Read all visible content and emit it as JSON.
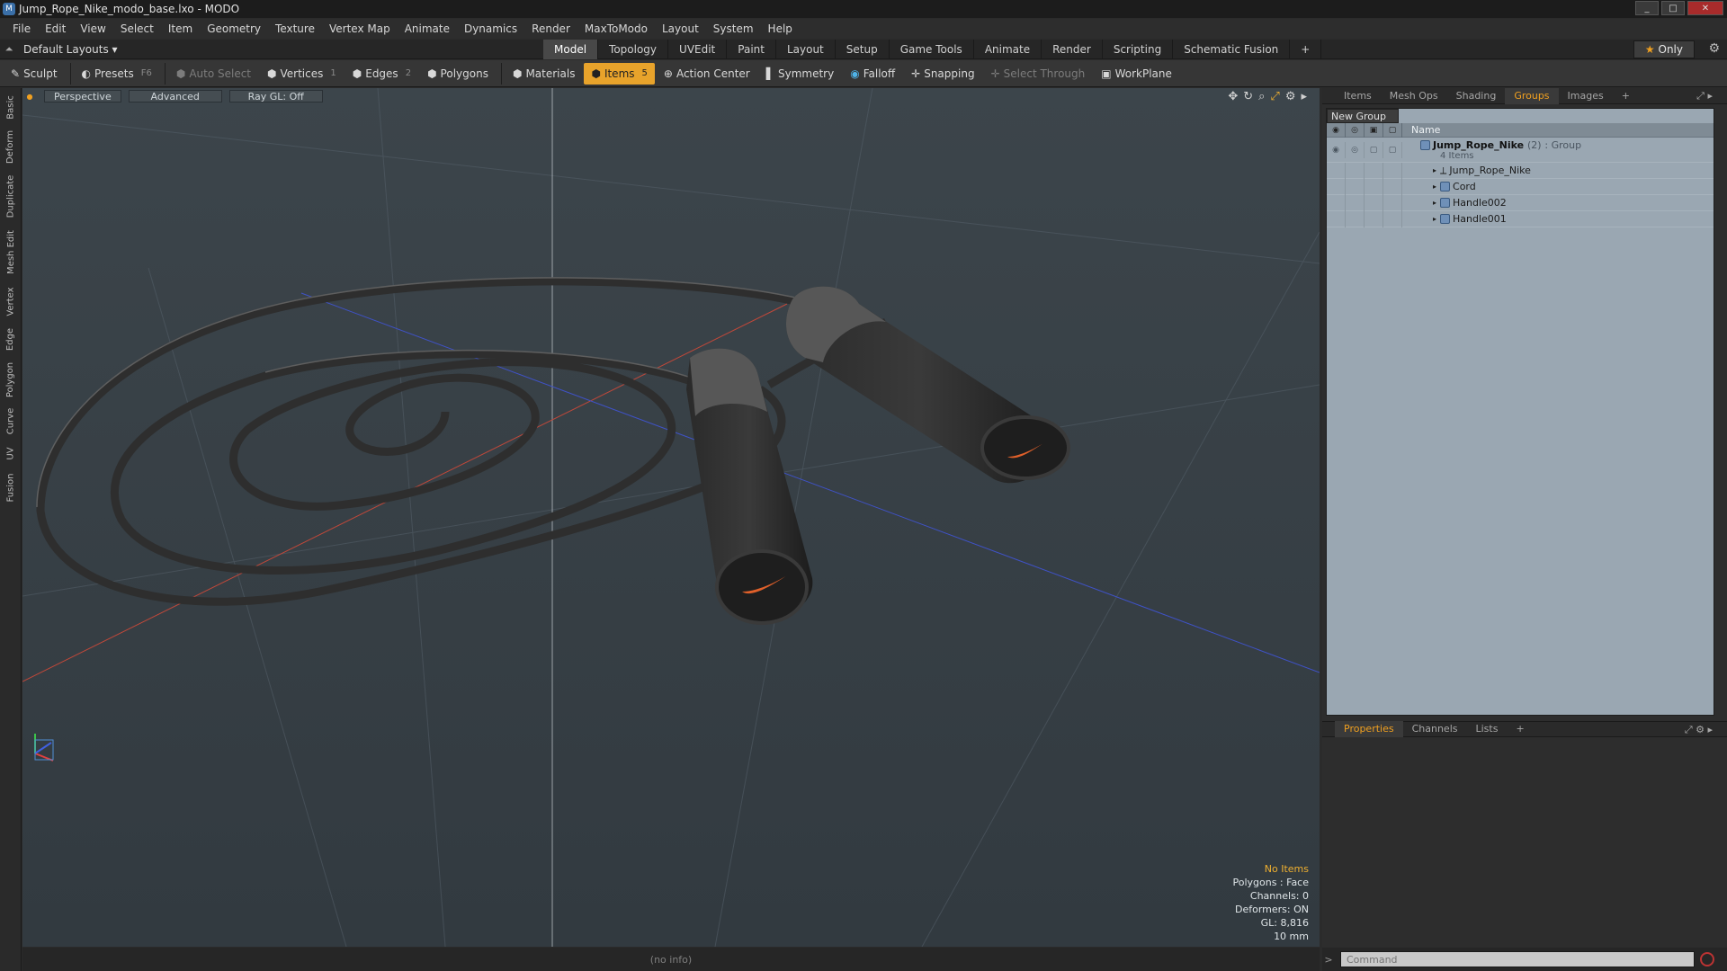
{
  "window": {
    "title": "Jump_Rope_Nike_modo_base.lxo - MODO",
    "controls": [
      "_",
      "□",
      "✕"
    ]
  },
  "menu": [
    "File",
    "Edit",
    "View",
    "Select",
    "Item",
    "Geometry",
    "Texture",
    "Vertex Map",
    "Animate",
    "Dynamics",
    "Render",
    "MaxToModo",
    "Layout",
    "System",
    "Help"
  ],
  "layouts": {
    "label": "Default Layouts ▾",
    "tabs": [
      "Model",
      "Topology",
      "UVEdit",
      "Paint",
      "Layout",
      "Setup",
      "Game Tools",
      "Animate",
      "Render",
      "Scripting",
      "Schematic Fusion",
      "+"
    ],
    "active": "Model",
    "only": "Only"
  },
  "toolbar": {
    "sculpt": "Sculpt",
    "presets": "Presets",
    "presets_key": "F6",
    "auto_select": "Auto Select",
    "vertices": "Vertices",
    "vertices_key": "1",
    "edges": "Edges",
    "edges_key": "2",
    "polygons": "Polygons",
    "materials": "Materials",
    "items": "Items",
    "items_key": "5",
    "action_center": "Action Center",
    "symmetry": "Symmetry",
    "falloff": "Falloff",
    "snapping": "Snapping",
    "select_through": "Select Through",
    "workplane": "WorkPlane"
  },
  "left_tabs": [
    "Basic",
    "Deform",
    "Duplicate",
    "Mesh Edit",
    "Vertex",
    "Edge",
    "Polygon",
    "Curve",
    "UV",
    "Fusion"
  ],
  "viewport": {
    "projection": "Perspective",
    "shading": "Advanced",
    "raygl": "Ray GL: Off",
    "info": {
      "selection": "No Items",
      "polygons": "Polygons : Face",
      "channels": "Channels: 0",
      "deformers": "Deformers: ON",
      "gl": "GL: 8,816",
      "unit": "10 mm"
    }
  },
  "status": "(no info)",
  "right_panel": {
    "tabs": [
      "Items",
      "Mesh Ops",
      "Shading",
      "Groups",
      "Images",
      "+"
    ],
    "active": "Groups",
    "new_group": "New Group",
    "column_name": "Name",
    "group": {
      "name": "Jump_Rope_Nike",
      "count": "(2)",
      "type": ": Group",
      "sub": "4 Items"
    },
    "children": [
      "Jump_Rope_Nike",
      "Cord",
      "Handle002",
      "Handle001"
    ]
  },
  "properties": {
    "tabs": [
      "Properties",
      "Channels",
      "Lists",
      "+"
    ],
    "active": "Properties"
  },
  "command": {
    "placeholder": "Command"
  },
  "colors": {
    "accent": "#f0a020",
    "viewport_bg": "#3a4248",
    "groups_bg": "#9aa7b2"
  }
}
